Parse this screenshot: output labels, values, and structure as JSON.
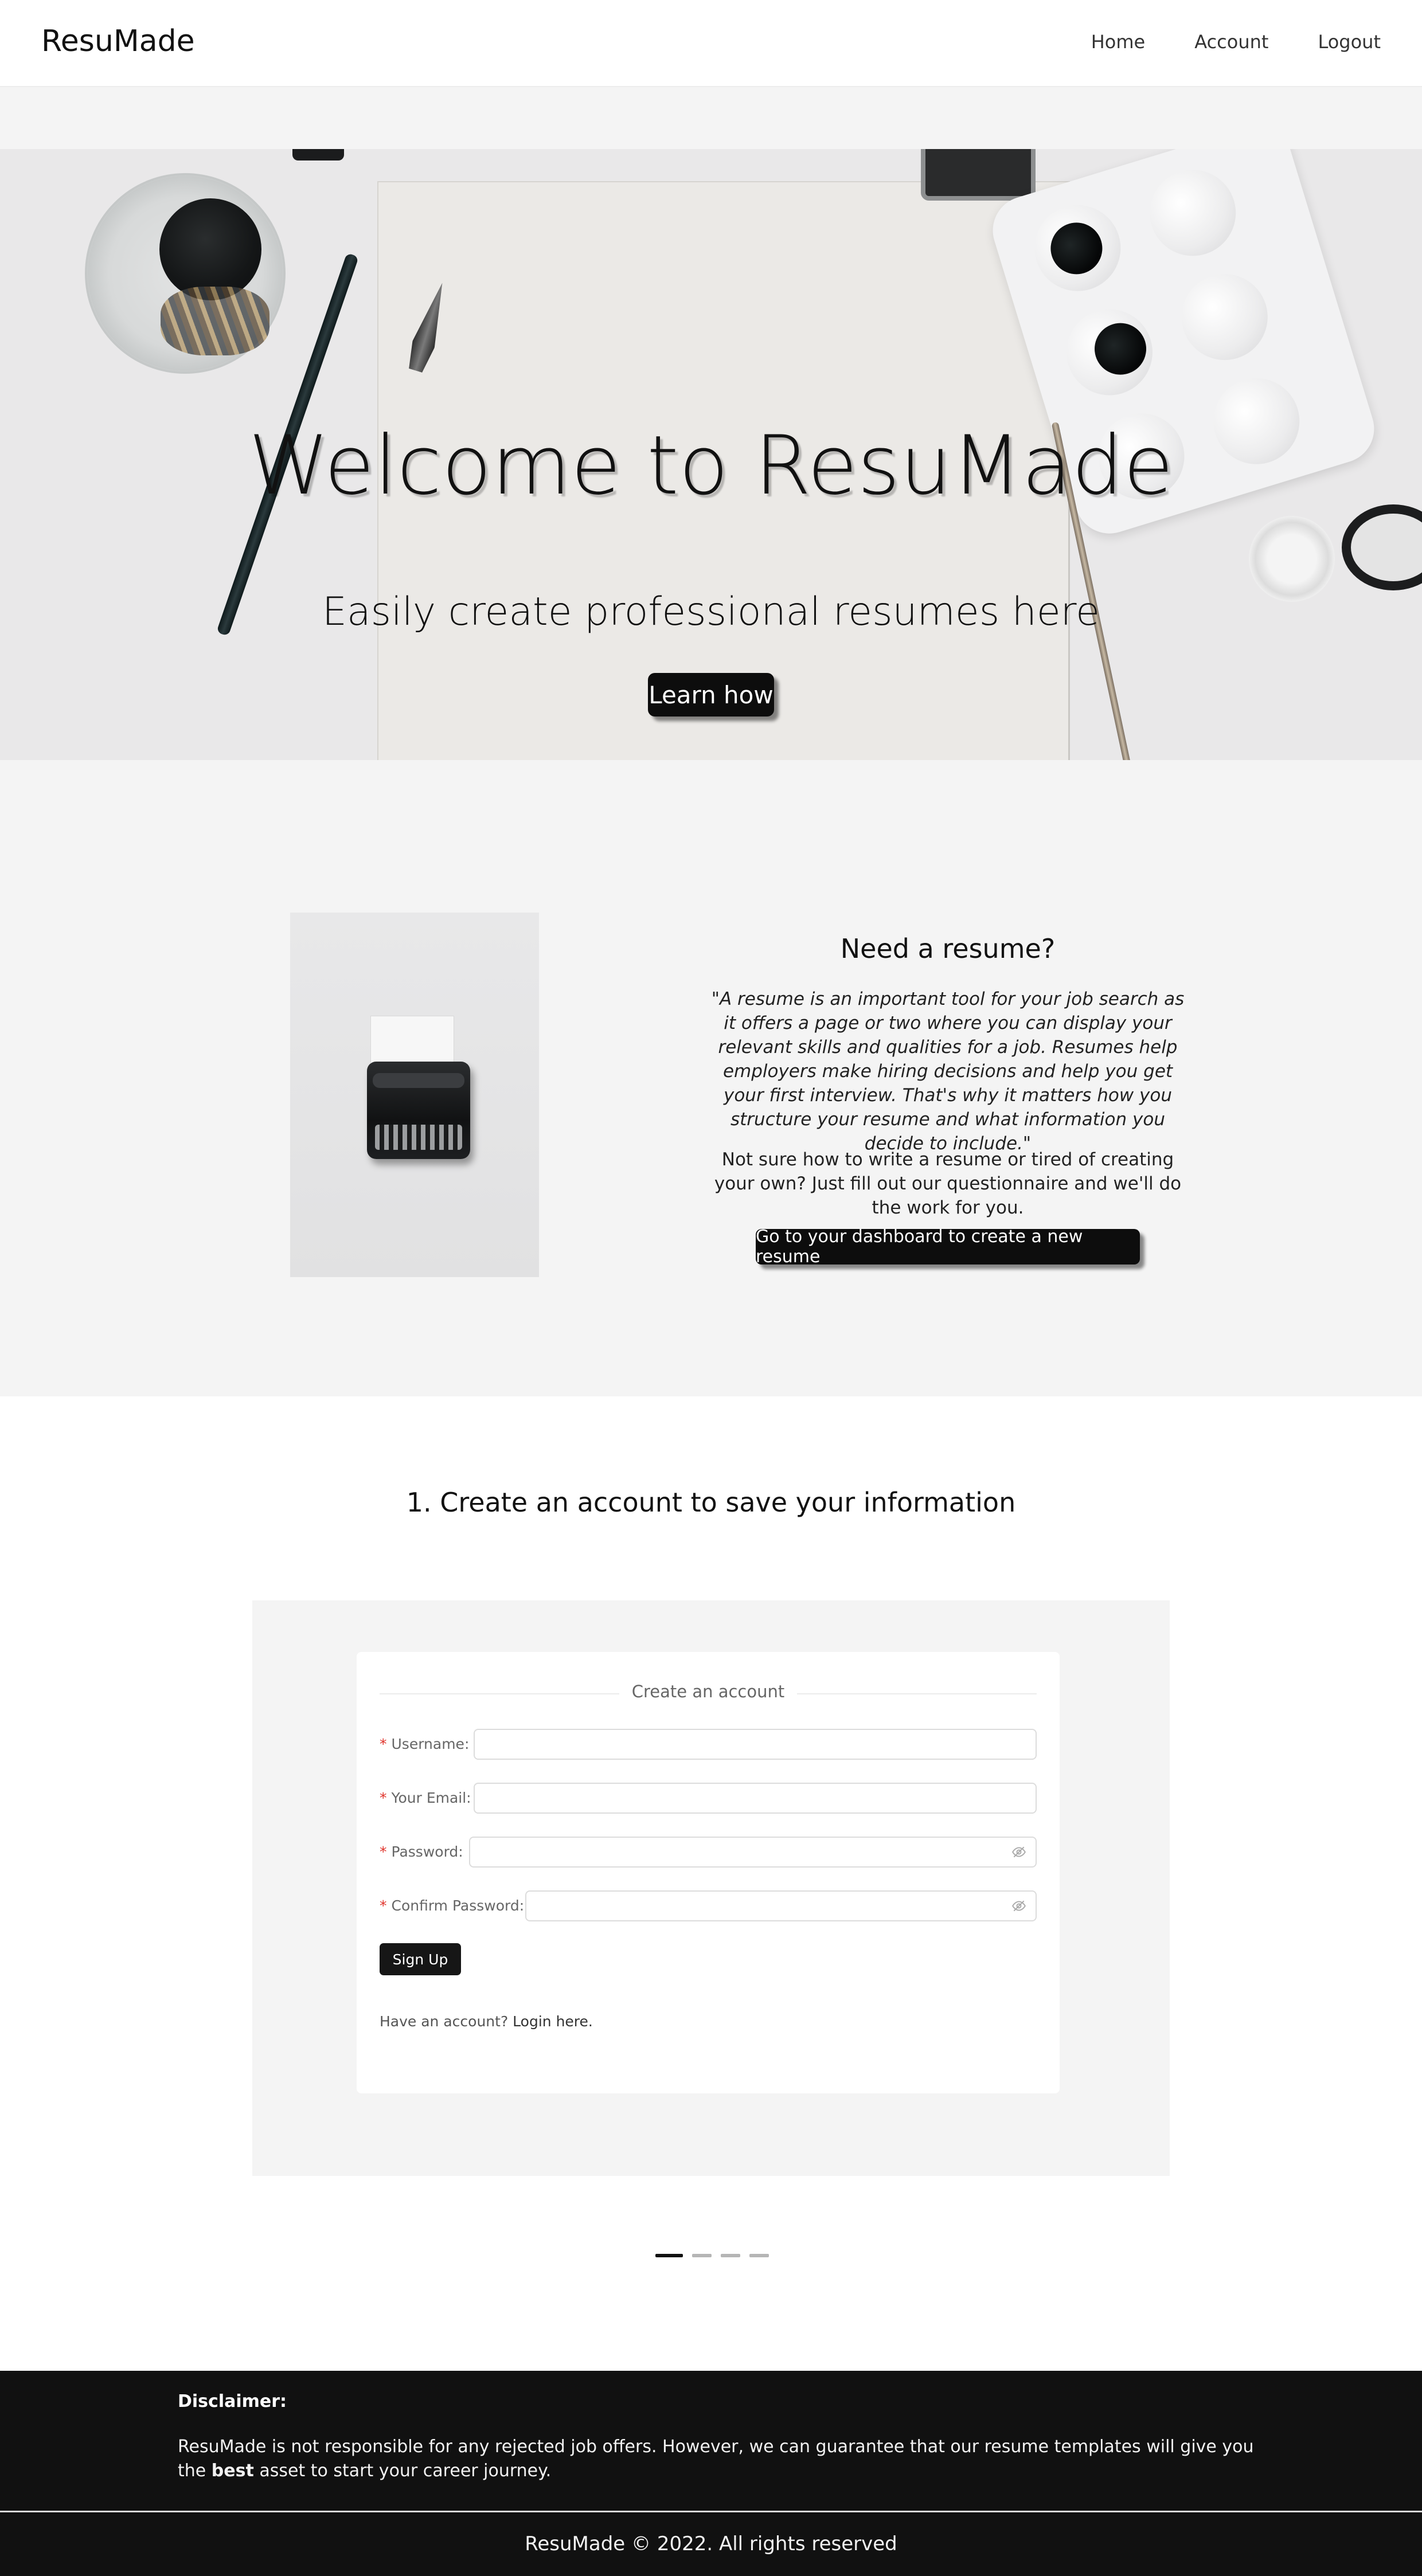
{
  "nav": {
    "brand": "ResuMade",
    "links": [
      "Home",
      "Account",
      "Logout"
    ]
  },
  "hero": {
    "title": "Welcome to ResuMade",
    "subtitle": "Easily create professional resumes here",
    "button": "Learn how"
  },
  "info": {
    "title": "Need a resume?",
    "quote": "\"A resume is an important tool for your job search as it offers a page or two where you can display your relevant skills and qualities for a job. Resumes help employers make hiring decisions and help you get your first interview. That's why it matters how you structure your resume and what information you decide to include.\"",
    "text": "Not sure how to write a resume or tired of creating your own? Just fill out our questionnaire and we'll do the work for you.",
    "button": "Go to your dashboard to create a new resume"
  },
  "step": {
    "title": "1. Create an account to save your information"
  },
  "form": {
    "legend": "Create an account",
    "required_mark": "*",
    "fields": [
      {
        "label": "Username:",
        "value": ""
      },
      {
        "label": "Your Email:",
        "value": ""
      },
      {
        "label": "Password:",
        "value": ""
      },
      {
        "label": "Confirm Password:",
        "value": ""
      }
    ],
    "signup": "Sign Up",
    "login_prompt": "Have an account?",
    "login_link": "Login here."
  },
  "carousel": {
    "slides": 4,
    "active_index": 0
  },
  "footer": {
    "disclaimer_title": "Disclaimer:",
    "disclaimer_before": "ResuMade is not responsible for any rejected job offers. However, we can guarantee that our resume templates will give you the ",
    "disclaimer_bold": "best",
    "disclaimer_after": " asset to start your career journey.",
    "copyright": "ResuMade © 2022. All rights reserved"
  }
}
